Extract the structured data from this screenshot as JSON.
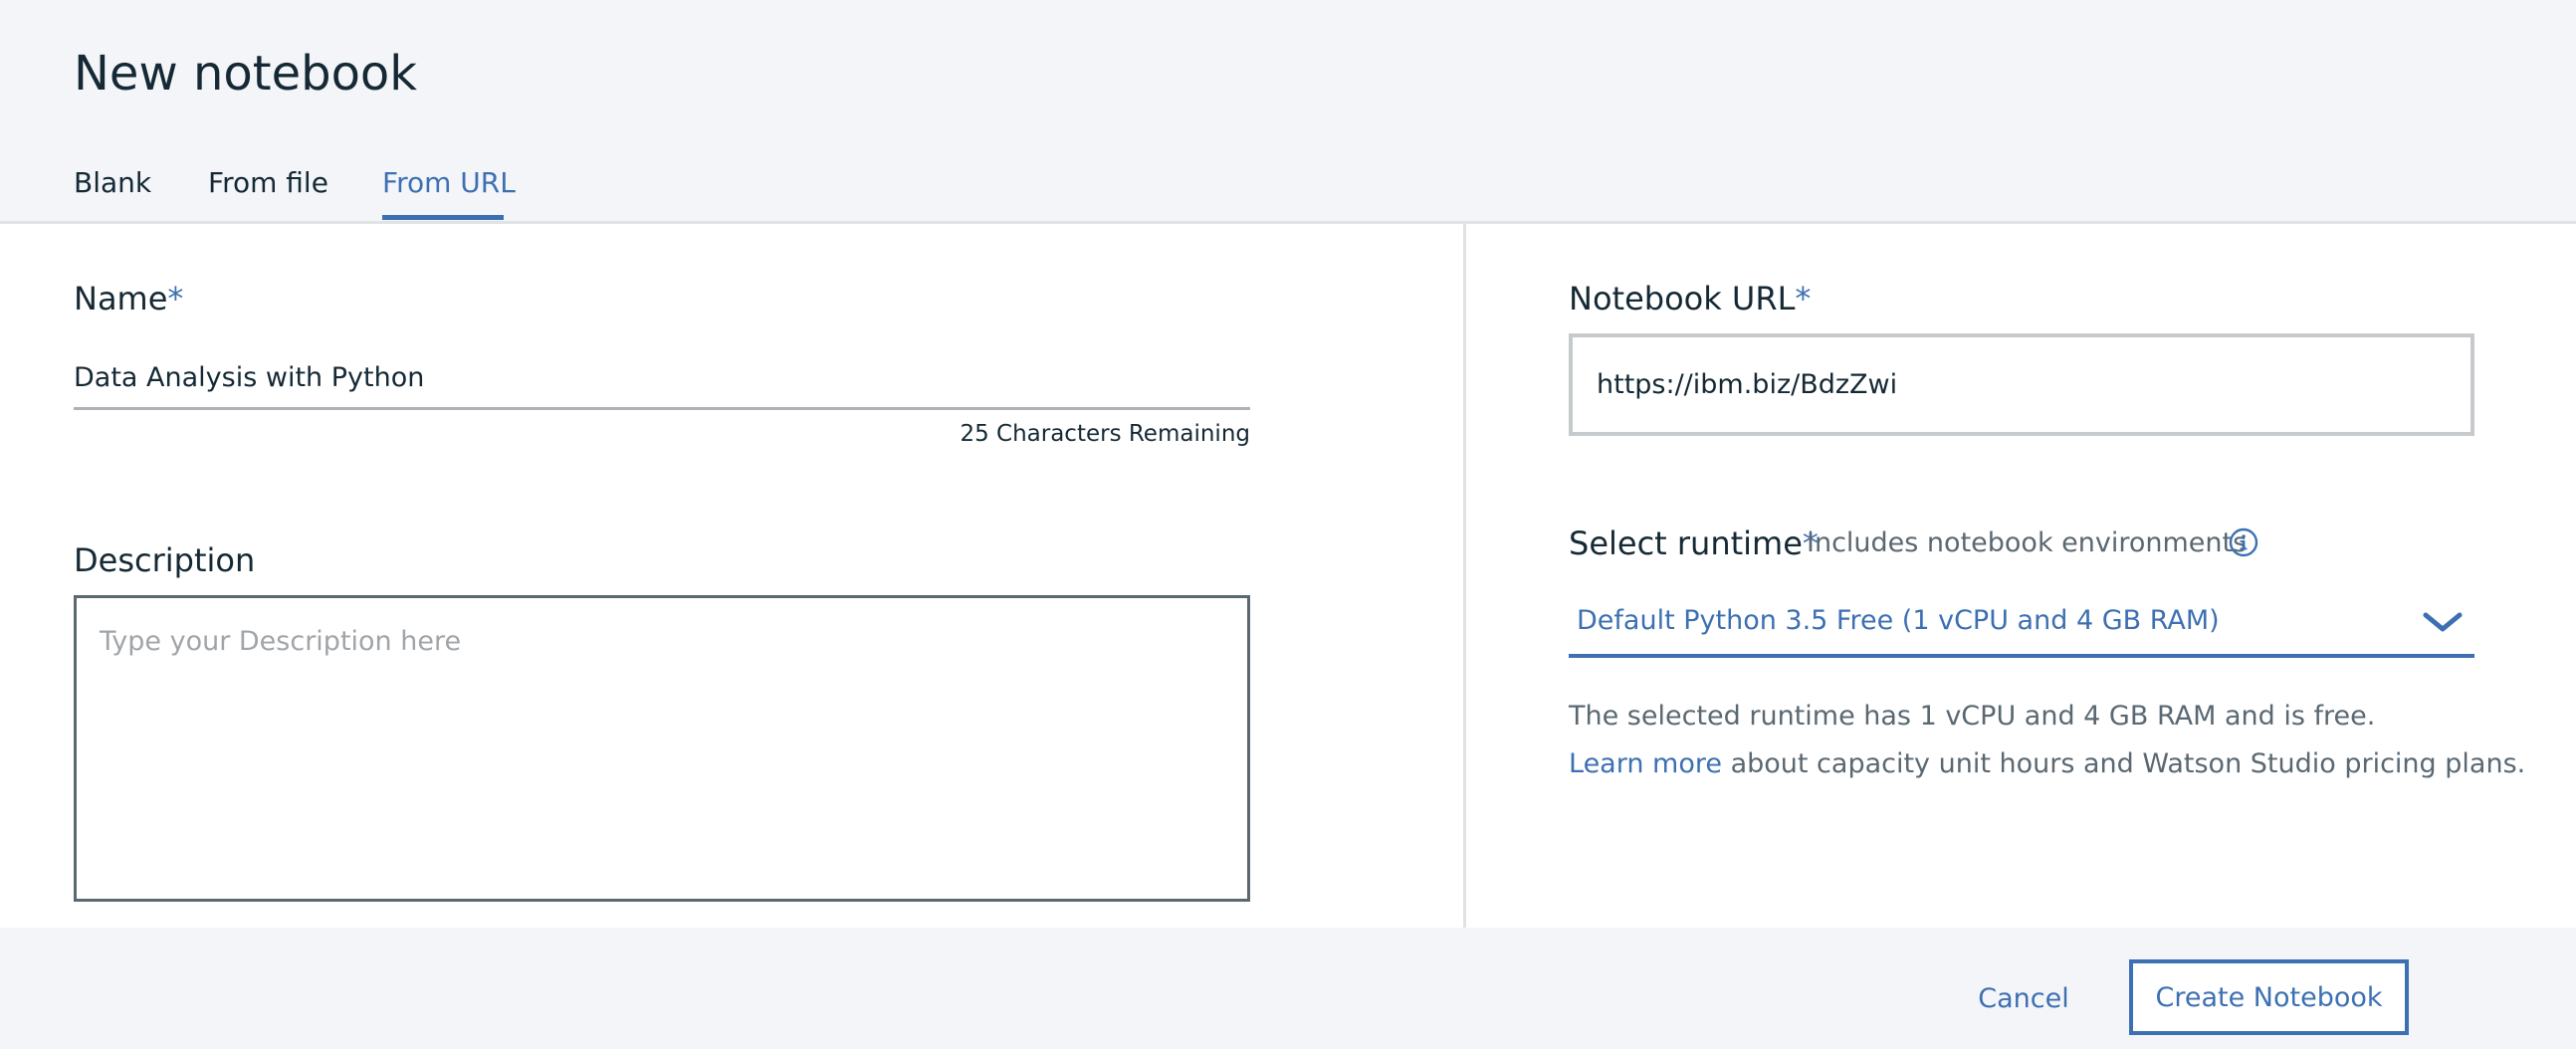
{
  "dialog": {
    "title": "New notebook"
  },
  "tabs": [
    {
      "label": "Blank",
      "active": false
    },
    {
      "label": "From file",
      "active": false
    },
    {
      "label": "From URL",
      "active": true
    }
  ],
  "form": {
    "name": {
      "label": "Name",
      "required_marker": "*",
      "value": "Data Analysis with Python",
      "remaining_text": "25 Characters Remaining"
    },
    "description": {
      "label": "Description",
      "placeholder": "Type your Description here",
      "value": ""
    },
    "notebook_url": {
      "label": "Notebook URL",
      "required_marker": "*",
      "value": "https://ibm.biz/BdzZwi"
    },
    "runtime": {
      "label": "Select runtime",
      "required_marker": "*",
      "sublabel": "Includes notebook environments",
      "selected": "Default Python 3.5 Free (1 vCPU and 4 GB RAM)",
      "info_text": "The selected runtime has 1 vCPU and 4 GB RAM and is free.",
      "learn_more_link": "Learn more",
      "learn_more_rest": " about capacity unit hours and Watson Studio pricing plans."
    }
  },
  "footer": {
    "cancel_label": "Cancel",
    "create_label": "Create Notebook"
  },
  "icons": {
    "info": "info-icon",
    "dropdown": "chevron-down-icon"
  },
  "colors": {
    "accent": "#3d70b2",
    "text": "#152935",
    "muted": "#5a6872",
    "header_bg": "#f4f5f9"
  }
}
